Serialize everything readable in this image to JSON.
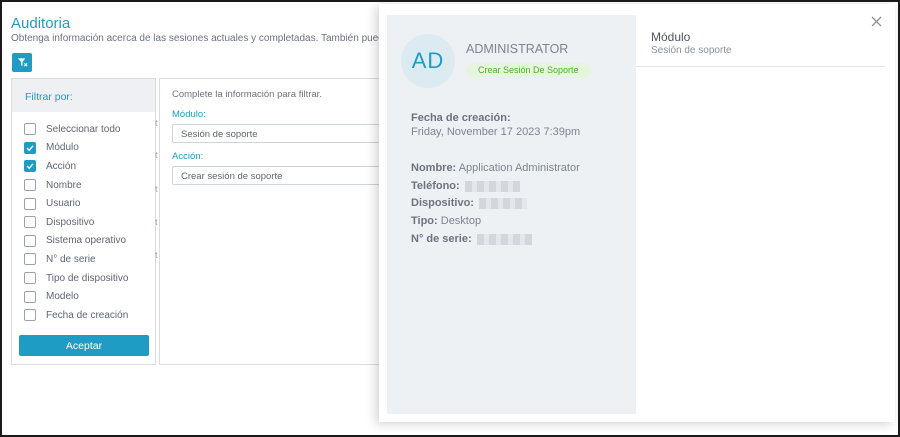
{
  "page": {
    "title": "Auditoria",
    "subtitle": "Obtenga información acerca de las sesiones actuales y completadas. También puede c"
  },
  "filter": {
    "header": "Filtrar por:",
    "items": [
      {
        "label": "Seleccionar todo",
        "checked": false
      },
      {
        "label": "Módulo",
        "checked": true
      },
      {
        "label": "Acción",
        "checked": true
      },
      {
        "label": "Nombre",
        "checked": false
      },
      {
        "label": "Usuario",
        "checked": false
      },
      {
        "label": "Dispositivo",
        "checked": false
      },
      {
        "label": "Sistema operativo",
        "checked": false
      },
      {
        "label": "N° de serie",
        "checked": false
      },
      {
        "label": "Tipo de dispositivo",
        "checked": false
      },
      {
        "label": "Modelo",
        "checked": false
      },
      {
        "label": "Fecha de creación",
        "checked": false
      }
    ],
    "accept_label": "Aceptar"
  },
  "form": {
    "hint": "Complete la información para filtrar.",
    "modulo_label": "Módulo:",
    "modulo_value": "Sesión de soporte",
    "accion_label": "Acción:",
    "accion_value": "Crear sesión de soporte"
  },
  "drawer": {
    "avatar_initials": "AD",
    "user_title": "ADMINISTRATOR",
    "badge": "Crear Sesión De Soporte",
    "created_label": "Fecha de creación:",
    "created_value": "Friday, November 17 2023 7:39pm",
    "nombre_label": "Nombre:",
    "nombre_value": "Application Administrator",
    "telefono_label": "Teléfono:",
    "dispositivo_label": "Dispositivo:",
    "tipo_label": "Tipo:",
    "tipo_value": "Desktop",
    "serie_label": "N° de serie:",
    "detail_title": "Módulo",
    "detail_subtitle": "Sesión de soporte"
  },
  "colors": {
    "accent": "#1f9cc4",
    "badge_bg": "#e6f5dd",
    "badge_text": "#4caf2e",
    "card_bg": "#eef1f4"
  },
  "icons": [
    "filter-icon",
    "check-icon",
    "close-icon"
  ]
}
